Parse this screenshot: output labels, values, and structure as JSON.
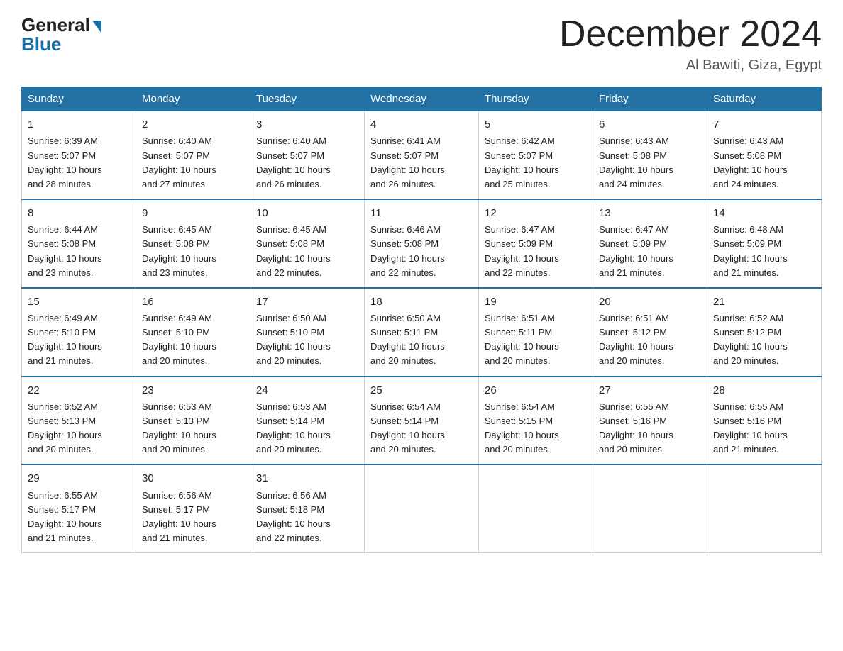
{
  "header": {
    "logo_general": "General",
    "logo_blue": "Blue",
    "month_title": "December 2024",
    "subtitle": "Al Bawiti, Giza, Egypt"
  },
  "days_of_week": [
    "Sunday",
    "Monday",
    "Tuesday",
    "Wednesday",
    "Thursday",
    "Friday",
    "Saturday"
  ],
  "weeks": [
    [
      {
        "day": "1",
        "sunrise": "6:39 AM",
        "sunset": "5:07 PM",
        "daylight": "10 hours and 28 minutes."
      },
      {
        "day": "2",
        "sunrise": "6:40 AM",
        "sunset": "5:07 PM",
        "daylight": "10 hours and 27 minutes."
      },
      {
        "day": "3",
        "sunrise": "6:40 AM",
        "sunset": "5:07 PM",
        "daylight": "10 hours and 26 minutes."
      },
      {
        "day": "4",
        "sunrise": "6:41 AM",
        "sunset": "5:07 PM",
        "daylight": "10 hours and 26 minutes."
      },
      {
        "day": "5",
        "sunrise": "6:42 AM",
        "sunset": "5:07 PM",
        "daylight": "10 hours and 25 minutes."
      },
      {
        "day": "6",
        "sunrise": "6:43 AM",
        "sunset": "5:08 PM",
        "daylight": "10 hours and 24 minutes."
      },
      {
        "day": "7",
        "sunrise": "6:43 AM",
        "sunset": "5:08 PM",
        "daylight": "10 hours and 24 minutes."
      }
    ],
    [
      {
        "day": "8",
        "sunrise": "6:44 AM",
        "sunset": "5:08 PM",
        "daylight": "10 hours and 23 minutes."
      },
      {
        "day": "9",
        "sunrise": "6:45 AM",
        "sunset": "5:08 PM",
        "daylight": "10 hours and 23 minutes."
      },
      {
        "day": "10",
        "sunrise": "6:45 AM",
        "sunset": "5:08 PM",
        "daylight": "10 hours and 22 minutes."
      },
      {
        "day": "11",
        "sunrise": "6:46 AM",
        "sunset": "5:08 PM",
        "daylight": "10 hours and 22 minutes."
      },
      {
        "day": "12",
        "sunrise": "6:47 AM",
        "sunset": "5:09 PM",
        "daylight": "10 hours and 22 minutes."
      },
      {
        "day": "13",
        "sunrise": "6:47 AM",
        "sunset": "5:09 PM",
        "daylight": "10 hours and 21 minutes."
      },
      {
        "day": "14",
        "sunrise": "6:48 AM",
        "sunset": "5:09 PM",
        "daylight": "10 hours and 21 minutes."
      }
    ],
    [
      {
        "day": "15",
        "sunrise": "6:49 AM",
        "sunset": "5:10 PM",
        "daylight": "10 hours and 21 minutes."
      },
      {
        "day": "16",
        "sunrise": "6:49 AM",
        "sunset": "5:10 PM",
        "daylight": "10 hours and 20 minutes."
      },
      {
        "day": "17",
        "sunrise": "6:50 AM",
        "sunset": "5:10 PM",
        "daylight": "10 hours and 20 minutes."
      },
      {
        "day": "18",
        "sunrise": "6:50 AM",
        "sunset": "5:11 PM",
        "daylight": "10 hours and 20 minutes."
      },
      {
        "day": "19",
        "sunrise": "6:51 AM",
        "sunset": "5:11 PM",
        "daylight": "10 hours and 20 minutes."
      },
      {
        "day": "20",
        "sunrise": "6:51 AM",
        "sunset": "5:12 PM",
        "daylight": "10 hours and 20 minutes."
      },
      {
        "day": "21",
        "sunrise": "6:52 AM",
        "sunset": "5:12 PM",
        "daylight": "10 hours and 20 minutes."
      }
    ],
    [
      {
        "day": "22",
        "sunrise": "6:52 AM",
        "sunset": "5:13 PM",
        "daylight": "10 hours and 20 minutes."
      },
      {
        "day": "23",
        "sunrise": "6:53 AM",
        "sunset": "5:13 PM",
        "daylight": "10 hours and 20 minutes."
      },
      {
        "day": "24",
        "sunrise": "6:53 AM",
        "sunset": "5:14 PM",
        "daylight": "10 hours and 20 minutes."
      },
      {
        "day": "25",
        "sunrise": "6:54 AM",
        "sunset": "5:14 PM",
        "daylight": "10 hours and 20 minutes."
      },
      {
        "day": "26",
        "sunrise": "6:54 AM",
        "sunset": "5:15 PM",
        "daylight": "10 hours and 20 minutes."
      },
      {
        "day": "27",
        "sunrise": "6:55 AM",
        "sunset": "5:16 PM",
        "daylight": "10 hours and 20 minutes."
      },
      {
        "day": "28",
        "sunrise": "6:55 AM",
        "sunset": "5:16 PM",
        "daylight": "10 hours and 21 minutes."
      }
    ],
    [
      {
        "day": "29",
        "sunrise": "6:55 AM",
        "sunset": "5:17 PM",
        "daylight": "10 hours and 21 minutes."
      },
      {
        "day": "30",
        "sunrise": "6:56 AM",
        "sunset": "5:17 PM",
        "daylight": "10 hours and 21 minutes."
      },
      {
        "day": "31",
        "sunrise": "6:56 AM",
        "sunset": "5:18 PM",
        "daylight": "10 hours and 22 minutes."
      },
      null,
      null,
      null,
      null
    ]
  ],
  "labels": {
    "sunrise": "Sunrise:",
    "sunset": "Sunset:",
    "daylight": "Daylight:"
  }
}
